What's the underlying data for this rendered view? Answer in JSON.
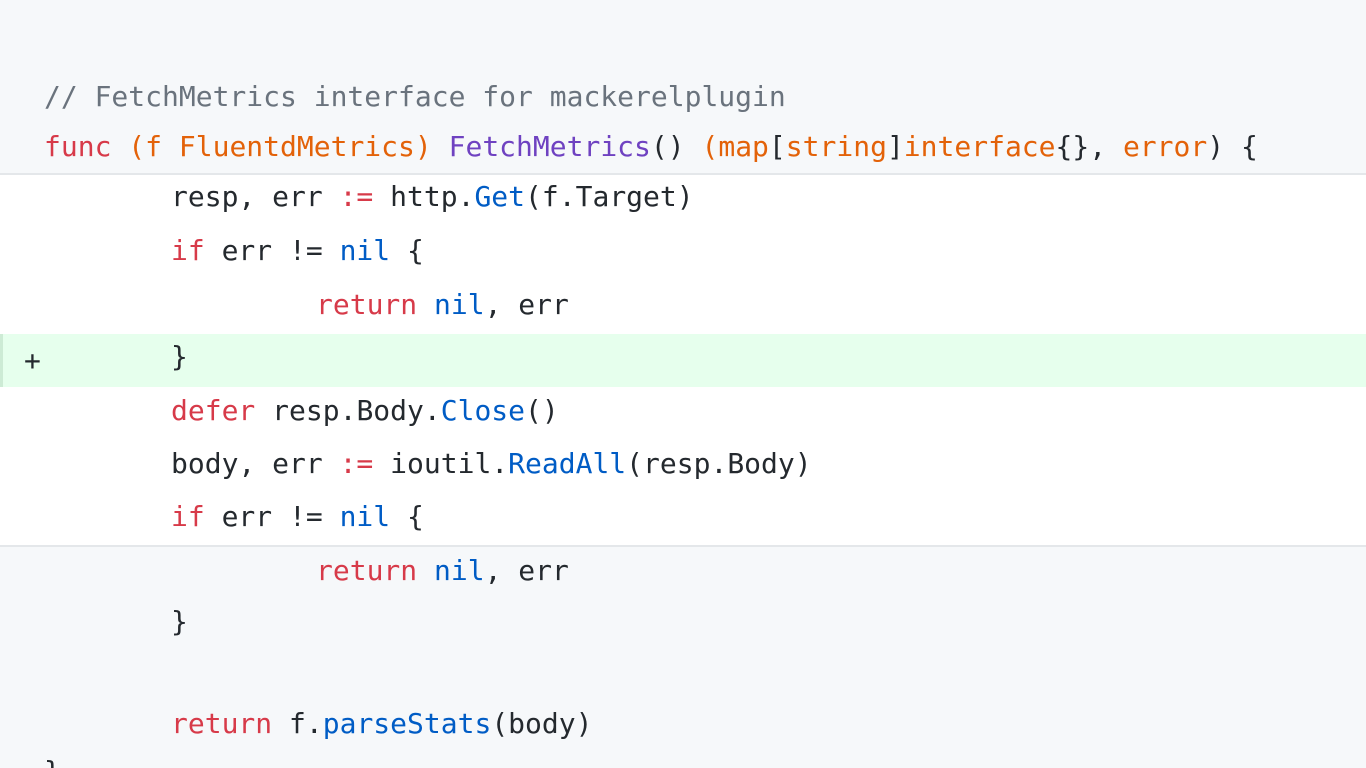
{
  "diff": {
    "added_marker": "+",
    "lines": [
      {
        "tokens": [
          {
            "t": "// FetchMetrics interface for mackerelplugin",
            "cls": "c"
          }
        ]
      },
      {
        "tokens": [
          {
            "t": "func",
            "cls": "k"
          },
          {
            "t": " ",
            "cls": "p"
          },
          {
            "t": "(f ",
            "cls": "v"
          },
          {
            "t": "FluentdMetrics",
            "cls": "v"
          },
          {
            "t": ")",
            "cls": "v"
          },
          {
            "t": " ",
            "cls": "p"
          },
          {
            "t": "FetchMetrics",
            "cls": "en"
          },
          {
            "t": "() ",
            "cls": "p"
          },
          {
            "t": "(",
            "cls": "v"
          },
          {
            "t": "map",
            "cls": "v"
          },
          {
            "t": "[",
            "cls": "p"
          },
          {
            "t": "string",
            "cls": "v"
          },
          {
            "t": "]",
            "cls": "p"
          },
          {
            "t": "interface",
            "cls": "v"
          },
          {
            "t": "{}, ",
            "cls": "p"
          },
          {
            "t": "error",
            "cls": "v"
          },
          {
            "t": ") {",
            "cls": "p"
          }
        ]
      },
      {
        "tokens": [
          {
            "t": "resp, err ",
            "cls": "p"
          },
          {
            "t": ":=",
            "cls": "k"
          },
          {
            "t": " http.",
            "cls": "p"
          },
          {
            "t": "Get",
            "cls": "fn"
          },
          {
            "t": "(f.Target)",
            "cls": "p"
          }
        ]
      },
      {
        "tokens": [
          {
            "t": "if",
            "cls": "k"
          },
          {
            "t": " err != ",
            "cls": "p"
          },
          {
            "t": "nil",
            "cls": "fn"
          },
          {
            "t": " {",
            "cls": "p"
          }
        ]
      },
      {
        "tokens": [
          {
            "t": "return",
            "cls": "k"
          },
          {
            "t": " ",
            "cls": "p"
          },
          {
            "t": "nil",
            "cls": "fn"
          },
          {
            "t": ", err",
            "cls": "p"
          }
        ]
      },
      {
        "tokens": [
          {
            "t": "}",
            "cls": "p"
          }
        ]
      },
      {
        "tokens": [
          {
            "t": "defer",
            "cls": "k"
          },
          {
            "t": " resp.Body.",
            "cls": "p"
          },
          {
            "t": "Close",
            "cls": "fn"
          },
          {
            "t": "()",
            "cls": "p"
          }
        ]
      },
      {
        "tokens": [
          {
            "t": "body, err ",
            "cls": "p"
          },
          {
            "t": ":=",
            "cls": "k"
          },
          {
            "t": " ioutil.",
            "cls": "p"
          },
          {
            "t": "ReadAll",
            "cls": "fn"
          },
          {
            "t": "(resp.Body)",
            "cls": "p"
          }
        ]
      },
      {
        "tokens": [
          {
            "t": "if",
            "cls": "k"
          },
          {
            "t": " err != ",
            "cls": "p"
          },
          {
            "t": "nil",
            "cls": "fn"
          },
          {
            "t": " {",
            "cls": "p"
          }
        ]
      },
      {
        "tokens": [
          {
            "t": "return",
            "cls": "k"
          },
          {
            "t": " ",
            "cls": "p"
          },
          {
            "t": "nil",
            "cls": "fn"
          },
          {
            "t": ", err",
            "cls": "p"
          }
        ]
      },
      {
        "tokens": [
          {
            "t": "}",
            "cls": "p"
          }
        ]
      },
      {
        "tokens": [
          {
            "t": "return",
            "cls": "k"
          },
          {
            "t": " f.",
            "cls": "p"
          },
          {
            "t": "parseStats",
            "cls": "fn"
          },
          {
            "t": "(body)",
            "cls": "p"
          }
        ]
      },
      {
        "tokens": [
          {
            "t": "}",
            "cls": "p"
          }
        ]
      }
    ]
  },
  "colors": {
    "keyword": "#d73a49",
    "comment": "#6a737d",
    "entity": "#6f42c1",
    "variable": "#e36209",
    "function": "#005cc5",
    "text": "#24292e",
    "added_background": "#e6ffed",
    "context_background": "#f6f8fa"
  }
}
